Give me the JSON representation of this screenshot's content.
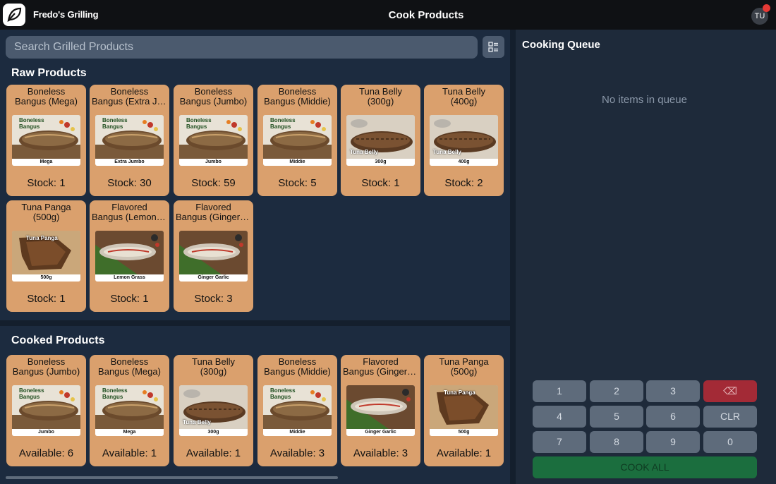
{
  "app": {
    "brand": "Fredo's Grilling",
    "title": "Cook Products",
    "user_initials": "TU"
  },
  "search": {
    "placeholder": "Search Grilled Products"
  },
  "raw": {
    "title": "Raw Products",
    "items": [
      {
        "name1": "Boneless",
        "name2": "Bangus (Mega)",
        "caption": "Mega",
        "stock": "Stock: 1"
      },
      {
        "name1": "Boneless",
        "name2": "Bangus (Extra Jumbo)",
        "caption": "Extra Jumbo",
        "stock": "Stock: 30"
      },
      {
        "name1": "Boneless",
        "name2": "Bangus (Jumbo)",
        "caption": "Jumbo",
        "stock": "Stock: 59"
      },
      {
        "name1": "Boneless",
        "name2": "Bangus (Middie)",
        "caption": "Middie",
        "stock": "Stock: 5"
      },
      {
        "name1": "Tuna Belly",
        "name2": "(300g)",
        "caption": "300g",
        "stock": "Stock: 1"
      },
      {
        "name1": "Tuna Belly",
        "name2": "(400g)",
        "caption": "400g",
        "stock": "Stock: 2"
      },
      {
        "name1": "Tuna Panga",
        "name2": "(500g)",
        "caption": "500g",
        "stock": "Stock: 1"
      },
      {
        "name1": "Flavored",
        "name2": "Bangus (Lemon Grass)",
        "caption": "Lemon Grass",
        "stock": "Stock: 1"
      },
      {
        "name1": "Flavored",
        "name2": "Bangus (Ginger Garlic)",
        "caption": "Ginger Garlic",
        "stock": "Stock: 3"
      }
    ]
  },
  "cooked": {
    "title": "Cooked Products",
    "items": [
      {
        "name1": "Boneless",
        "name2": "Bangus (Jumbo)",
        "caption": "Jumbo",
        "stock": "Available: 6"
      },
      {
        "name1": "Boneless",
        "name2": "Bangus (Mega)",
        "caption": "Mega",
        "stock": "Available: 1"
      },
      {
        "name1": "Tuna Belly",
        "name2": "(300g)",
        "caption": "300g",
        "stock": "Available: 1"
      },
      {
        "name1": "Boneless",
        "name2": "Bangus (Middie)",
        "caption": "Middie",
        "stock": "Available: 3"
      },
      {
        "name1": "Flavored",
        "name2": "Bangus (Ginger Garlic)",
        "caption": "Ginger Garlic",
        "stock": "Available: 3"
      },
      {
        "name1": "Tuna Panga",
        "name2": "(500g)",
        "caption": "500g",
        "stock": "Available: 1"
      }
    ]
  },
  "image_text": {
    "bangus": "Boneless Bangus",
    "tuna_belly": "Tuna Belly",
    "tuna_panga": "Tuna Panga"
  },
  "queue": {
    "title": "Cooking Queue",
    "empty": "No items in queue"
  },
  "keypad": {
    "k1": "1",
    "k2": "2",
    "k3": "3",
    "del": "⌫",
    "k4": "4",
    "k5": "5",
    "k6": "6",
    "clr": "CLR",
    "k7": "7",
    "k8": "8",
    "k9": "9",
    "k0": "0",
    "cook_all": "COOK ALL"
  },
  "colors": {
    "card": "#daa06d",
    "panel": "#1c2b3f",
    "delete": "#a32a36",
    "cook_all": "#1b6e3e",
    "notification": "#e53935"
  }
}
